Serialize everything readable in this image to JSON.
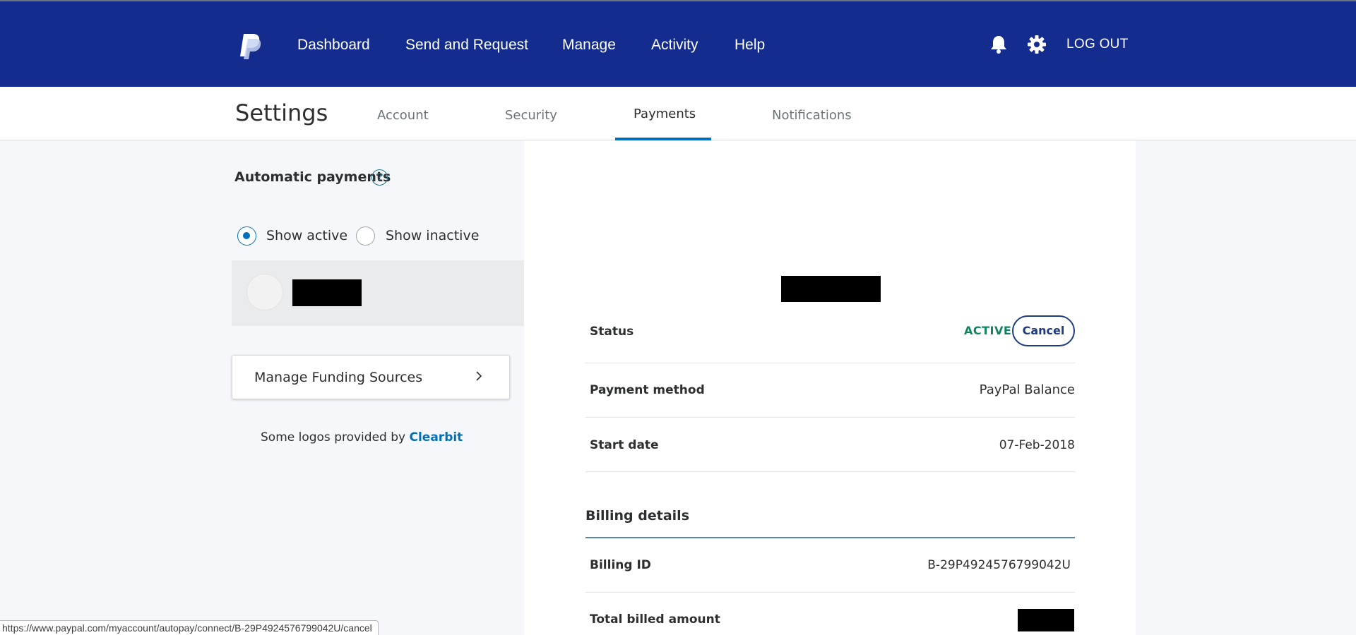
{
  "nav": {
    "items": [
      {
        "label": "Dashboard"
      },
      {
        "label": "Send and Request"
      },
      {
        "label": "Manage"
      },
      {
        "label": "Activity"
      },
      {
        "label": "Help"
      }
    ],
    "logout_label": "LOG OUT",
    "icons": {
      "logo": "paypal-logo",
      "notifications": "bell-icon",
      "settings": "gear-icon"
    },
    "bar_color": "#142c8e"
  },
  "settings": {
    "title": "Settings",
    "tabs": [
      {
        "label": "Account"
      },
      {
        "label": "Security"
      },
      {
        "label": "Payments"
      },
      {
        "label": "Notifications"
      }
    ],
    "active_tab": "Payments"
  },
  "autopay": {
    "title": "Automatic payments",
    "help_icon": "?",
    "filters": [
      {
        "label": "Show active",
        "checked": true
      },
      {
        "label": "Show inactive",
        "checked": false
      }
    ],
    "funding_label": "Manage Funding Sources",
    "logos_note_prefix": "Some logos provided by",
    "logos_note_link": "Clearbit"
  },
  "details": {
    "status_label": "Status",
    "status_value": "ACTIVE",
    "cancel_label": "Cancel",
    "payment_method_label": "Payment method",
    "payment_method_value": "PayPal Balance",
    "start_date_label": "Start date",
    "start_date_value": "07-Feb-2018",
    "billing_heading": "Billing details",
    "billing_id_label": "Billing ID",
    "billing_id_value": "B-29P4924576799042U",
    "total_billed_label": "Total billed amount",
    "active_color": "#10835f"
  },
  "statusbar": {
    "url": "https://www.paypal.com/myaccount/autopay/connect/B-29P4924576799042U/cancel"
  }
}
